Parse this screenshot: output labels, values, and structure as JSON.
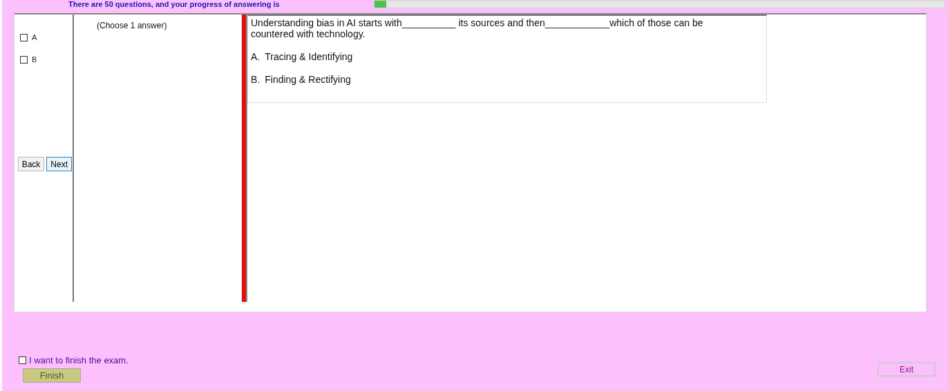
{
  "header": {
    "text": "There are 50 questions, and your progress of answering is",
    "progress": {
      "level": 0.02
    }
  },
  "answers": [
    {
      "label": "A",
      "checked": false
    },
    {
      "label": "B",
      "checked": false
    }
  ],
  "nav_buttons": [
    {
      "label": "Back",
      "selected": false
    },
    {
      "label": "Next",
      "selected": true
    }
  ],
  "instruction": "(Choose 1 answer)",
  "question": {
    "text": "Understanding bias in AI starts with__________ its sources and then____________which of those can be countered with technology.",
    "options": [
      {
        "label": "A.",
        "text": "Tracing & Identifying"
      },
      {
        "label": "B.",
        "text": "Finding & Rectifying"
      }
    ]
  },
  "finish": {
    "label": "I want to finish the exam.",
    "checked": false,
    "button": "Finish"
  },
  "exit_button": "Exit"
}
